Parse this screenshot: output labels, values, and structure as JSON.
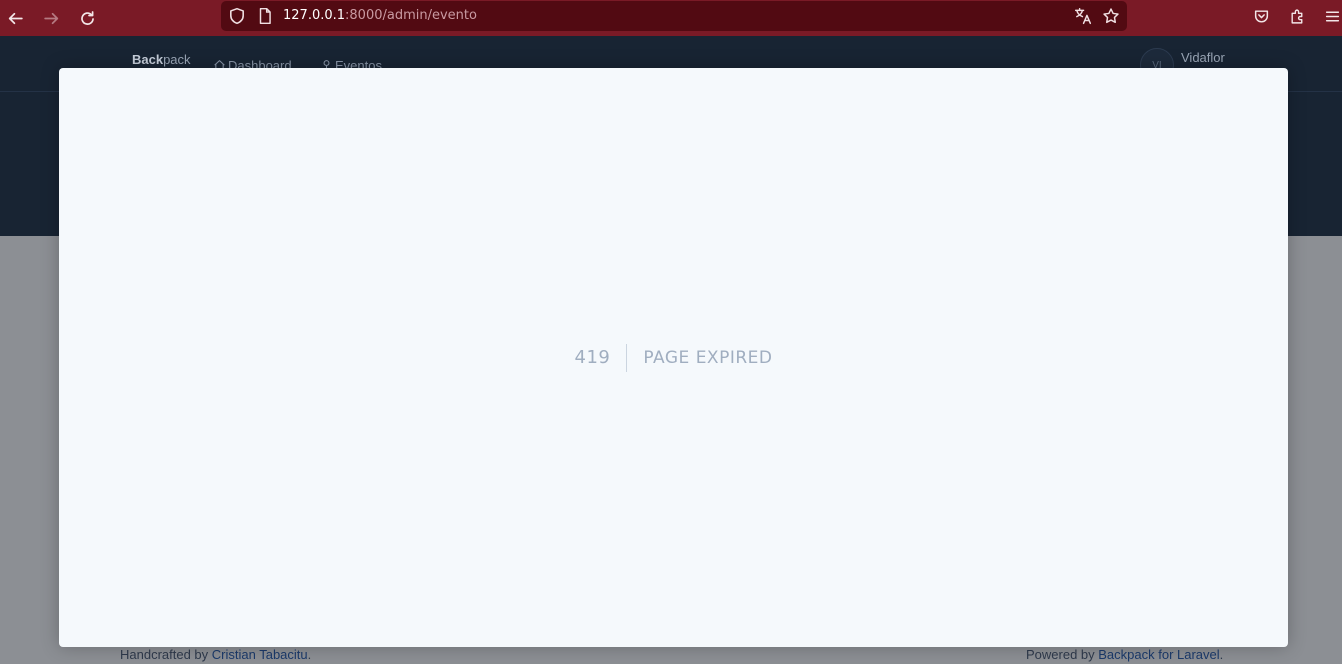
{
  "browser": {
    "url_host": "127.0.0.1",
    "url_rest": ":8000/admin/evento"
  },
  "app": {
    "brand_bold": "Back",
    "brand_rest": "pack",
    "nav": [
      {
        "label": "Dashboard",
        "icon": "home-icon"
      },
      {
        "label": "Eventos",
        "icon": "pin-icon"
      }
    ],
    "avatar_initials": "VI",
    "user_name": "Vidaflor"
  },
  "footer": {
    "left_prefix": "Handcrafted by ",
    "left_link": "Cristian Tabacitu",
    "left_suffix": ".",
    "right_prefix": "Powered by ",
    "right_link": "Backpack for Laravel",
    "right_suffix": "."
  },
  "error": {
    "code": "419",
    "message": "Page Expired"
  }
}
